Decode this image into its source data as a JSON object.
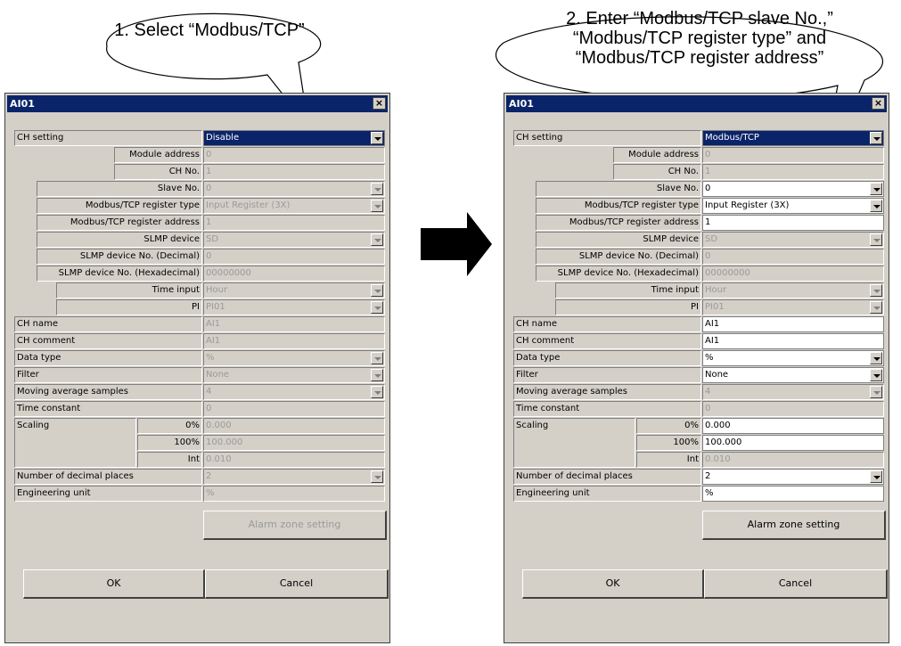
{
  "callouts": {
    "left": "1. Select “Modbus/TCP”",
    "right_lines": [
      "2. Enter “Modbus/TCP slave No.,”",
      "“Modbus/TCP register type” and",
      "“Modbus/TCP register address”"
    ]
  },
  "dialogs": [
    {
      "title": "AI01",
      "close": "×",
      "labels": {
        "ch_setting": "CH setting",
        "module_address": "Module address",
        "ch_no": "CH No.",
        "slave_no": "Slave No.",
        "reg_type": "Modbus/TCP register type",
        "reg_address": "Modbus/TCP register address",
        "slmp_device": "SLMP device",
        "slmp_dec": "SLMP device No. (Decimal)",
        "slmp_hex": "SLMP device No. (Hexadecimal)",
        "time_input": "Time input",
        "pi": "PI",
        "ch_name": "CH name",
        "ch_comment": "CH comment",
        "data_type": "Data type",
        "filter": "Filter",
        "mov_avg": "Moving average samples",
        "time_const": "Time constant",
        "scaling": "Scaling",
        "pct0": "0%",
        "pct100": "100%",
        "int": "Int",
        "decimals": "Number of decimal places",
        "eng_unit": "Engineering unit"
      },
      "values": {
        "ch_setting": "Disable",
        "module_address": "0",
        "ch_no": "1",
        "slave_no": "0",
        "reg_type": "Input Register (3X)",
        "reg_address": "1",
        "slmp_device": "SD",
        "slmp_dec": "0",
        "slmp_hex": "00000000",
        "time_input": "Hour",
        "pi": "PI01",
        "ch_name": "AI1",
        "ch_comment": "AI1",
        "data_type": "%",
        "filter": "None",
        "mov_avg": "4",
        "time_const": "0",
        "scale0": "0.000",
        "scale100": "100.000",
        "int": "0.010",
        "decimals": "2",
        "eng_unit": "%"
      },
      "buttons": {
        "alarm": "Alarm zone setting",
        "ok": "OK",
        "cancel": "Cancel"
      }
    },
    {
      "title": "AI01",
      "close": "×",
      "labels": {
        "ch_setting": "CH setting",
        "module_address": "Module address",
        "ch_no": "CH No.",
        "slave_no": "Slave No.",
        "reg_type": "Modbus/TCP register type",
        "reg_address": "Modbus/TCP register address",
        "slmp_device": "SLMP device",
        "slmp_dec": "SLMP device No. (Decimal)",
        "slmp_hex": "SLMP device No. (Hexadecimal)",
        "time_input": "Time input",
        "pi": "PI",
        "ch_name": "CH name",
        "ch_comment": "CH comment",
        "data_type": "Data type",
        "filter": "Filter",
        "mov_avg": "Moving average samples",
        "time_const": "Time constant",
        "scaling": "Scaling",
        "pct0": "0%",
        "pct100": "100%",
        "int": "Int",
        "decimals": "Number of decimal places",
        "eng_unit": "Engineering unit"
      },
      "values": {
        "ch_setting": "Modbus/TCP",
        "module_address": "0",
        "ch_no": "1",
        "slave_no": "0",
        "reg_type": "Input Register (3X)",
        "reg_address": "1",
        "slmp_device": "SD",
        "slmp_dec": "0",
        "slmp_hex": "00000000",
        "time_input": "Hour",
        "pi": "PI01",
        "ch_name": "AI1",
        "ch_comment": "AI1",
        "data_type": "%",
        "filter": "None",
        "mov_avg": "4",
        "time_const": "0",
        "scale0": "0.000",
        "scale100": "100.000",
        "int": "0.010",
        "decimals": "2",
        "eng_unit": "%"
      },
      "buttons": {
        "alarm": "Alarm zone setting",
        "ok": "OK",
        "cancel": "Cancel"
      }
    }
  ]
}
